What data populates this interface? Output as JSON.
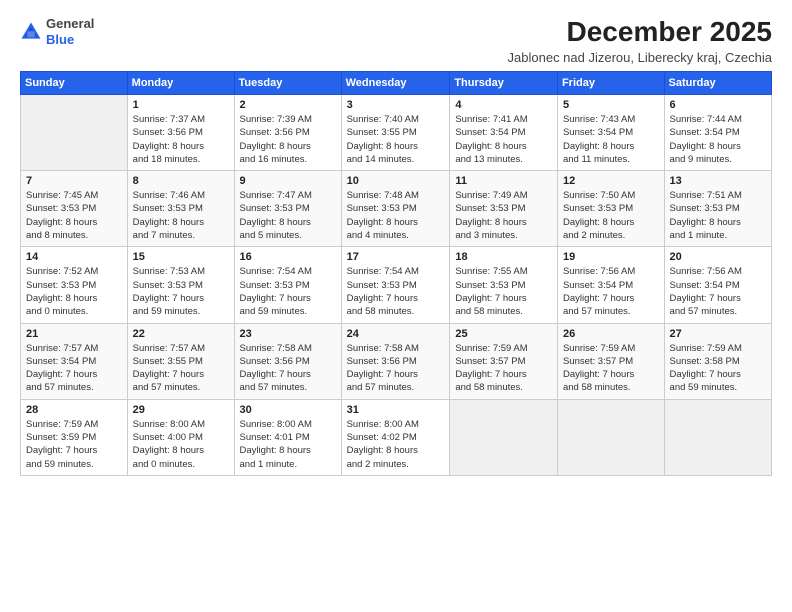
{
  "header": {
    "logo_line1": "General",
    "logo_line2": "Blue",
    "title": "December 2025",
    "subtitle": "Jablonec nad Jizerou, Liberecky kraj, Czechia"
  },
  "columns": [
    "Sunday",
    "Monday",
    "Tuesday",
    "Wednesday",
    "Thursday",
    "Friday",
    "Saturday"
  ],
  "weeks": [
    [
      {
        "day": "",
        "info": ""
      },
      {
        "day": "1",
        "info": "Sunrise: 7:37 AM\nSunset: 3:56 PM\nDaylight: 8 hours\nand 18 minutes."
      },
      {
        "day": "2",
        "info": "Sunrise: 7:39 AM\nSunset: 3:56 PM\nDaylight: 8 hours\nand 16 minutes."
      },
      {
        "day": "3",
        "info": "Sunrise: 7:40 AM\nSunset: 3:55 PM\nDaylight: 8 hours\nand 14 minutes."
      },
      {
        "day": "4",
        "info": "Sunrise: 7:41 AM\nSunset: 3:54 PM\nDaylight: 8 hours\nand 13 minutes."
      },
      {
        "day": "5",
        "info": "Sunrise: 7:43 AM\nSunset: 3:54 PM\nDaylight: 8 hours\nand 11 minutes."
      },
      {
        "day": "6",
        "info": "Sunrise: 7:44 AM\nSunset: 3:54 PM\nDaylight: 8 hours\nand 9 minutes."
      }
    ],
    [
      {
        "day": "7",
        "info": "Sunrise: 7:45 AM\nSunset: 3:53 PM\nDaylight: 8 hours\nand 8 minutes."
      },
      {
        "day": "8",
        "info": "Sunrise: 7:46 AM\nSunset: 3:53 PM\nDaylight: 8 hours\nand 7 minutes."
      },
      {
        "day": "9",
        "info": "Sunrise: 7:47 AM\nSunset: 3:53 PM\nDaylight: 8 hours\nand 5 minutes."
      },
      {
        "day": "10",
        "info": "Sunrise: 7:48 AM\nSunset: 3:53 PM\nDaylight: 8 hours\nand 4 minutes."
      },
      {
        "day": "11",
        "info": "Sunrise: 7:49 AM\nSunset: 3:53 PM\nDaylight: 8 hours\nand 3 minutes."
      },
      {
        "day": "12",
        "info": "Sunrise: 7:50 AM\nSunset: 3:53 PM\nDaylight: 8 hours\nand 2 minutes."
      },
      {
        "day": "13",
        "info": "Sunrise: 7:51 AM\nSunset: 3:53 PM\nDaylight: 8 hours\nand 1 minute."
      }
    ],
    [
      {
        "day": "14",
        "info": "Sunrise: 7:52 AM\nSunset: 3:53 PM\nDaylight: 8 hours\nand 0 minutes."
      },
      {
        "day": "15",
        "info": "Sunrise: 7:53 AM\nSunset: 3:53 PM\nDaylight: 7 hours\nand 59 minutes."
      },
      {
        "day": "16",
        "info": "Sunrise: 7:54 AM\nSunset: 3:53 PM\nDaylight: 7 hours\nand 59 minutes."
      },
      {
        "day": "17",
        "info": "Sunrise: 7:54 AM\nSunset: 3:53 PM\nDaylight: 7 hours\nand 58 minutes."
      },
      {
        "day": "18",
        "info": "Sunrise: 7:55 AM\nSunset: 3:53 PM\nDaylight: 7 hours\nand 58 minutes."
      },
      {
        "day": "19",
        "info": "Sunrise: 7:56 AM\nSunset: 3:54 PM\nDaylight: 7 hours\nand 57 minutes."
      },
      {
        "day": "20",
        "info": "Sunrise: 7:56 AM\nSunset: 3:54 PM\nDaylight: 7 hours\nand 57 minutes."
      }
    ],
    [
      {
        "day": "21",
        "info": "Sunrise: 7:57 AM\nSunset: 3:54 PM\nDaylight: 7 hours\nand 57 minutes."
      },
      {
        "day": "22",
        "info": "Sunrise: 7:57 AM\nSunset: 3:55 PM\nDaylight: 7 hours\nand 57 minutes."
      },
      {
        "day": "23",
        "info": "Sunrise: 7:58 AM\nSunset: 3:56 PM\nDaylight: 7 hours\nand 57 minutes."
      },
      {
        "day": "24",
        "info": "Sunrise: 7:58 AM\nSunset: 3:56 PM\nDaylight: 7 hours\nand 57 minutes."
      },
      {
        "day": "25",
        "info": "Sunrise: 7:59 AM\nSunset: 3:57 PM\nDaylight: 7 hours\nand 58 minutes."
      },
      {
        "day": "26",
        "info": "Sunrise: 7:59 AM\nSunset: 3:57 PM\nDaylight: 7 hours\nand 58 minutes."
      },
      {
        "day": "27",
        "info": "Sunrise: 7:59 AM\nSunset: 3:58 PM\nDaylight: 7 hours\nand 59 minutes."
      }
    ],
    [
      {
        "day": "28",
        "info": "Sunrise: 7:59 AM\nSunset: 3:59 PM\nDaylight: 7 hours\nand 59 minutes."
      },
      {
        "day": "29",
        "info": "Sunrise: 8:00 AM\nSunset: 4:00 PM\nDaylight: 8 hours\nand 0 minutes."
      },
      {
        "day": "30",
        "info": "Sunrise: 8:00 AM\nSunset: 4:01 PM\nDaylight: 8 hours\nand 1 minute."
      },
      {
        "day": "31",
        "info": "Sunrise: 8:00 AM\nSunset: 4:02 PM\nDaylight: 8 hours\nand 2 minutes."
      },
      {
        "day": "",
        "info": ""
      },
      {
        "day": "",
        "info": ""
      },
      {
        "day": "",
        "info": ""
      }
    ]
  ]
}
